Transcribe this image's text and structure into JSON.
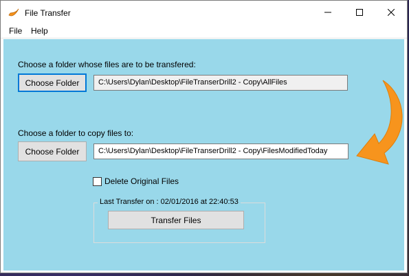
{
  "window": {
    "title": "File Transfer",
    "controls": {
      "minimize": "—",
      "maximize": "☐",
      "close": "✕"
    }
  },
  "menu": {
    "file": "File",
    "help": "Help"
  },
  "source": {
    "prompt": "Choose a folder whose files are to be transfered:",
    "button": "Choose Folder",
    "path": "C:\\Users\\Dylan\\Desktop\\FileTranserDrill2 - Copy\\AllFiles"
  },
  "destination": {
    "prompt": "Choose a folder to copy files to:",
    "button": "Choose Folder",
    "path": "C:\\Users\\Dylan\\Desktop\\FileTranserDrill2 - Copy\\FilesModifiedToday"
  },
  "options": {
    "delete_original": "Delete Original Files",
    "delete_checked": false
  },
  "transfer": {
    "last_transfer": "Last Transfer on : 02/01/2016 at 22:40:53",
    "button": "Transfer Files"
  },
  "colors": {
    "panel": "#99d8ea",
    "arrow": "#f7941d",
    "focus": "#0078d7"
  },
  "icons": {
    "app": "boomerang-icon",
    "decoration": "curved-arrow-icon"
  }
}
